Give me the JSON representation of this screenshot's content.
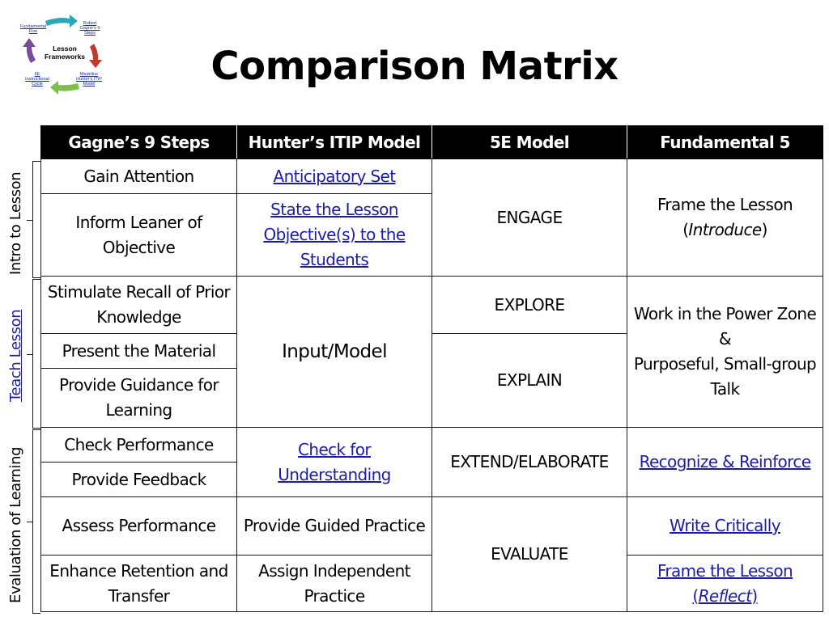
{
  "title": "Comparison Matrix",
  "logo": {
    "center_title_line1": "Lesson",
    "center_title_line2": "Frameworks",
    "links": [
      {
        "label_line1": "Fundamental",
        "label_line2": "Five"
      },
      {
        "label_line1": "Robert",
        "label_line2": "Gagne's 9",
        "label_line3": "Steps"
      },
      {
        "label_line1": "Madeline",
        "label_line2": "Hunter's ITIP",
        "label_line3": "Model"
      },
      {
        "label_line1": "5E",
        "label_line2": "Instructional",
        "label_line3": "Cycle"
      }
    ],
    "arrow_colors": {
      "top": "#2aa8b8",
      "right": "#c0392b",
      "bottom": "#7cc04a",
      "left": "#7a4c9e"
    }
  },
  "side_labels": [
    {
      "label": "Intro to Lesson",
      "is_link": false
    },
    {
      "label": "Teach Lesson",
      "is_link": true
    },
    {
      "label": "Evaluation of Learning",
      "is_link": false
    }
  ],
  "table": {
    "headers": [
      "Gagne’s 9 Steps",
      "Hunter’s ITIP Model",
      "5E Model",
      "Fundamental 5"
    ],
    "gagne": [
      "Gain Attention",
      "Inform Leaner of Objective",
      "Stimulate Recall of Prior Knowledge",
      "Present the Material",
      "Provide Guidance for Learning",
      "Check Performance",
      "Provide Feedback",
      "Assess Performance",
      "Enhance Retention and Transfer"
    ],
    "hunter": [
      {
        "text": "Anticipatory Set",
        "is_link": true
      },
      {
        "text": "State the Lesson Objective(s) to the Students",
        "is_link": true
      },
      {
        "text": "Input/Model",
        "is_link": false
      },
      {
        "text": "Check for Understanding",
        "is_link": true
      },
      {
        "text": "Provide Guided Practice",
        "is_link": false
      },
      {
        "text": "Assign Independent Practice",
        "is_link": false
      }
    ],
    "five_e": [
      "ENGAGE",
      "EXPLORE",
      "EXPLAIN",
      "EXTEND/ELABORATE",
      "EVALUATE"
    ],
    "fundamental": {
      "frame_intro_main": "Frame the Lesson",
      "frame_intro_paren": "Introduce",
      "power_zone_line1": "Work in the Power Zone",
      "power_zone_amp": "&",
      "power_zone_line2": "Purposeful, Small-group Talk",
      "recognize": "Recognize & Reinforce",
      "write": "Write Critically",
      "frame_reflect_main": "Frame the Lesson",
      "frame_reflect_paren": "Reflect"
    }
  },
  "colors": {
    "header_bg": "#000000",
    "header_text": "#ffffff",
    "link": "#1c1ca8",
    "border": "#1a1a1a"
  }
}
